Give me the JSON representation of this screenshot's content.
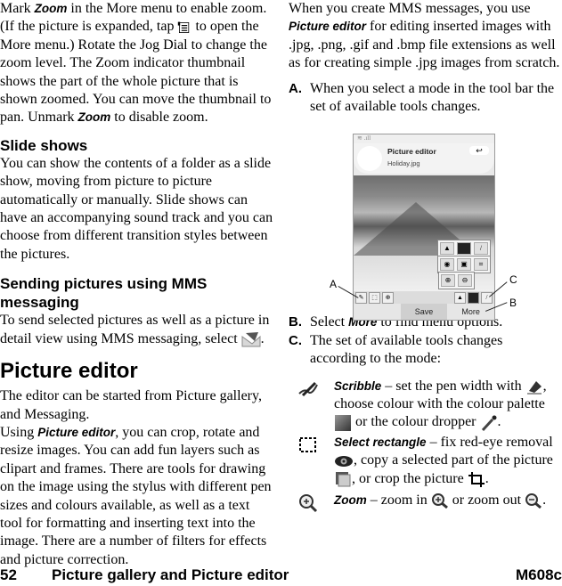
{
  "left_column": {
    "zoom_paragraph": {
      "part1": "Mark ",
      "zoom_term": "Zoom",
      "part2": " in the More menu to enable zoom. (If the picture is expanded, tap ",
      "part3": " to open the More menu.) Rotate the Jog Dial to change the zoom level. The Zoom indicator thumbnail shows the part of the whole picture that is shown zoomed. You can move the thumbnail to pan. Unmark ",
      "zoom_term2": "Zoom",
      "part4": " to disable zoom.",
      "icon": "more-menu-icon"
    },
    "slide_shows": {
      "heading": "Slide shows",
      "body": "You can show the contents of a folder as a slide show, moving from picture to picture automatically or manually. Slide shows can have an accompanying sound track and you can choose from different transition styles between the pictures."
    },
    "mms": {
      "heading": "Sending pictures using MMS messaging",
      "body": "To send selected pictures as well as a picture in detail view using MMS messaging, select ",
      "end": ".",
      "icon": "mms-send-icon"
    },
    "picture_editor": {
      "heading": "Picture editor",
      "intro": "The editor can be started from Picture gallery, and Messaging.",
      "using_prefix": "Using ",
      "using_term": "Picture editor",
      "using_body": ", you can crop, rotate and resize images. You can add fun layers such as clipart and frames. There are tools for drawing on the image using the stylus with different pen sizes and colours available, as well as a text tool for formatting and inserting text into the image. There are a number of filters for effects and picture correction."
    }
  },
  "right_column": {
    "intro": {
      "part1": "When you create MMS messages, you use ",
      "term": "Picture editor",
      "part2": " for editing inserted images with .jpg, .png, .gif and .bmp file extensions as well as for creating simple .jpg images from scratch."
    },
    "item_a": {
      "letter": "A.",
      "text": "When you select a mode in the tool bar the set of available tools changes."
    },
    "item_b": {
      "letter": "B.",
      "prefix": "Select ",
      "term": "More",
      "suffix": " to find menu options."
    },
    "item_c": {
      "letter": "C.",
      "text": " The set of available tools changes according to the mode:"
    },
    "tools": [
      {
        "icon": "scribble-icon",
        "term": "Scribble",
        "text1": " – set the pen width with ",
        "icon2": "pen-width-icon",
        "text2": ", choose colour with the colour palette ",
        "icon3": "colour-palette-icon",
        "text3": " or the colour dropper ",
        "icon4": "colour-dropper-icon",
        "text4": "."
      },
      {
        "icon": "select-rectangle-icon",
        "term": "Select rectangle",
        "text1": " – fix red-eye removal ",
        "icon2": "red-eye-icon",
        "text2": ", copy a selected part of the picture ",
        "icon3": "copy-icon",
        "text3": ", or crop the picture ",
        "icon4": "crop-icon",
        "text4": "."
      },
      {
        "icon": "zoom-icon",
        "term": "Zoom",
        "text1": " – zoom in ",
        "icon2": "zoom-in-icon",
        "text2": " or zoom out ",
        "icon3": "zoom-out-icon",
        "text3": "."
      }
    ]
  },
  "phone_screenshot": {
    "app_title": "Picture editor",
    "file_name": "Holiday.jpg",
    "softkeys": [
      "",
      "Save",
      "More"
    ],
    "callouts": [
      "A",
      "B",
      "C"
    ]
  },
  "footer": {
    "page_number": "52",
    "chapter": "Picture gallery and Picture editor",
    "model": "M608c"
  }
}
